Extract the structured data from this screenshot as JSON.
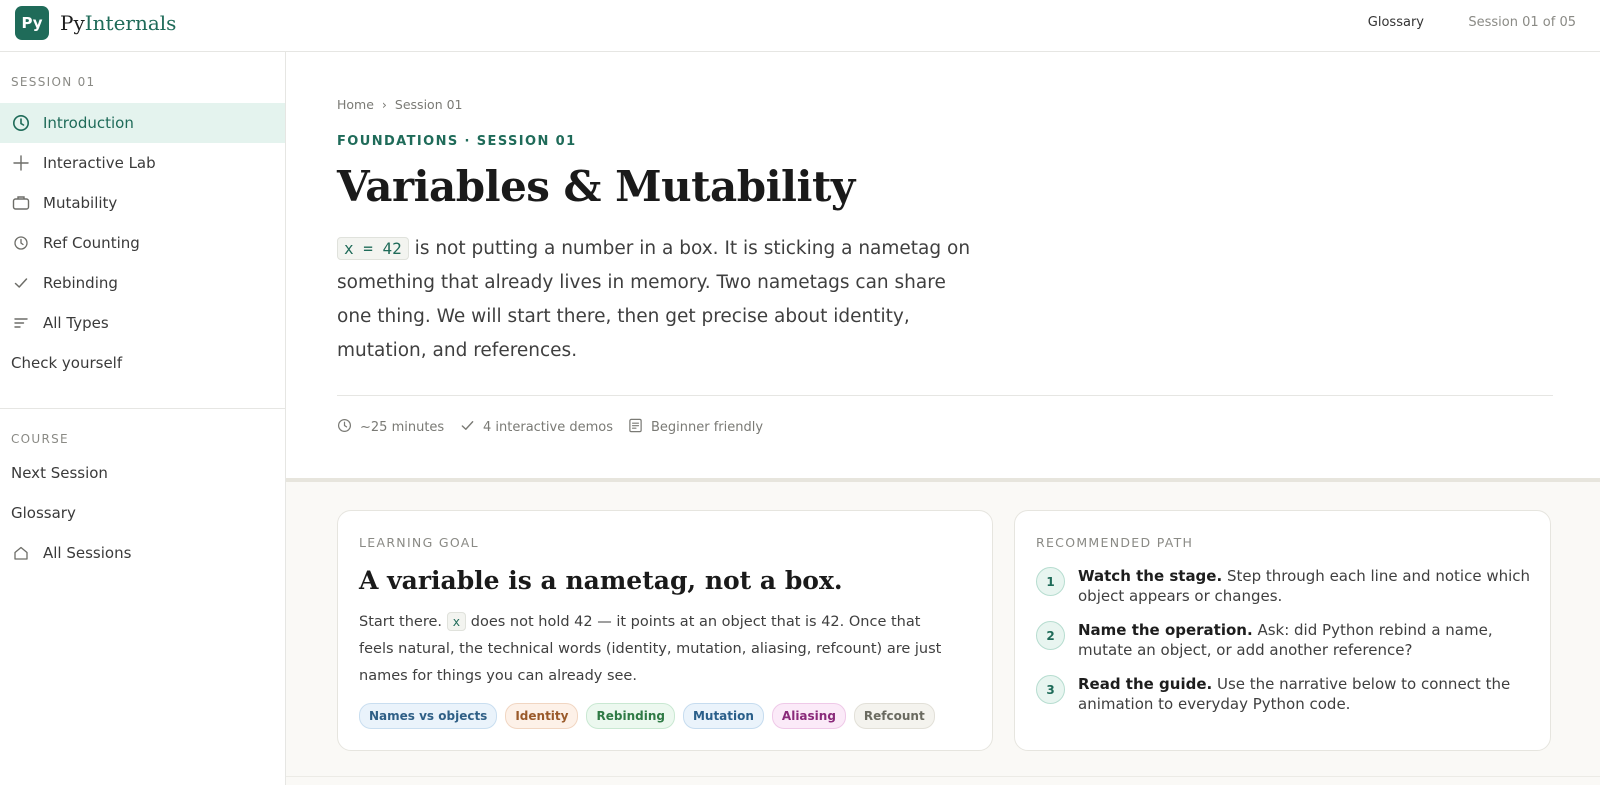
{
  "header": {
    "logo_text": "Py",
    "brand_primary": "Py",
    "brand_accent": "Internals",
    "nav_glossary": "Glossary",
    "session_indicator": "Session 01 of 05"
  },
  "sidebar": {
    "session_heading": "SESSION 01",
    "session_items": [
      {
        "label": "Introduction",
        "icon": "clock-icon",
        "active": true
      },
      {
        "label": "Interactive Lab",
        "icon": "plus-icon"
      },
      {
        "label": "Mutability",
        "icon": "briefcase-icon"
      },
      {
        "label": "Ref Counting",
        "icon": "clock-small-icon"
      },
      {
        "label": "Rebinding",
        "icon": "check-icon"
      },
      {
        "label": "All Types",
        "icon": "list-icon"
      },
      {
        "label": "Check yourself",
        "icon": ""
      }
    ],
    "course_heading": "COURSE",
    "course_items": [
      {
        "label": "Next Session",
        "icon": ""
      },
      {
        "label": "Glossary",
        "icon": ""
      },
      {
        "label": "All Sessions",
        "icon": "home-icon"
      }
    ]
  },
  "main": {
    "breadcrumb": {
      "home": "Home",
      "separator": "›",
      "current": "Session 01"
    },
    "eyebrow": "FOUNDATIONS · SESSION 01",
    "title": "Variables & Mutability",
    "lede_code": "x = 42",
    "lede_text": " is not putting a number in a box. It is sticking a nametag on something that already lives in memory. Two nametags can share one thing. We will start there, then get precise about identity, mutation, and references.",
    "meta": {
      "duration": "~25 minutes",
      "demos": "4 interactive demos",
      "level": "Beginner friendly"
    }
  },
  "goal_card": {
    "label": "LEARNING GOAL",
    "title": "A variable is a nametag, not a box.",
    "text_start": "Start there. ",
    "text_code": "x",
    "text_rest": " does not hold 42 — it points at an object that is 42. Once that feels natural, the technical words (identity, mutation, aliasing, refcount) are just names for things you can already see.",
    "tags": [
      {
        "label": "Names vs objects",
        "color": "#2f5f86",
        "bg": "#eaf3fb",
        "border": "#c9def0"
      },
      {
        "label": "Identity",
        "color": "#9a5a2a",
        "bg": "#fdf1e8",
        "border": "#f1d6c2"
      },
      {
        "label": "Rebinding",
        "color": "#2f7a45",
        "bg": "#ecf8ef",
        "border": "#c9e8d2"
      },
      {
        "label": "Mutation",
        "color": "#2a5f8a",
        "bg": "#eaf3fb",
        "border": "#c6dcef"
      },
      {
        "label": "Aliasing",
        "color": "#8a2a7a",
        "bg": "#fbeaf8",
        "border": "#efc9e8"
      },
      {
        "label": "Refcount",
        "color": "#6a6a60",
        "bg": "#f4f3ee",
        "border": "#e2e0d8"
      }
    ]
  },
  "path_card": {
    "label": "RECOMMENDED PATH",
    "steps": [
      {
        "num": "1",
        "bold": "Watch the stage.",
        "text": " Step through each line and notice which object appears or changes."
      },
      {
        "num": "2",
        "bold": "Name the operation.",
        "text": " Ask: did Python rebind a name, mutate an object, or add another reference?"
      },
      {
        "num": "3",
        "bold": "Read the guide.",
        "text": " Use the narrative below to connect the animation to everyday Python code."
      }
    ]
  },
  "colors": {
    "accent": "#1f6b59",
    "active_bg": "#e4f3ee"
  }
}
